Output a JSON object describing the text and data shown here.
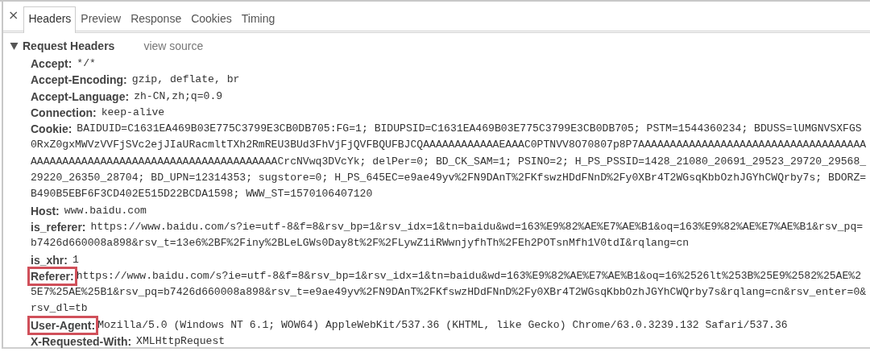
{
  "close_button": "×",
  "tabs": [
    {
      "label": "Headers",
      "selected": true
    },
    {
      "label": "Preview",
      "selected": false
    },
    {
      "label": "Response",
      "selected": false
    },
    {
      "label": "Cookies",
      "selected": false
    },
    {
      "label": "Timing",
      "selected": false
    }
  ],
  "section": {
    "title": "Request Headers",
    "expanded": true,
    "link": "view source",
    "headers": [
      {
        "name": "Accept:",
        "value": "*/*",
        "highlighted": false
      },
      {
        "name": "Accept-Encoding:",
        "value": "gzip, deflate, br",
        "highlighted": false
      },
      {
        "name": "Accept-Language:",
        "value": "zh-CN,zh;q=0.9",
        "highlighted": false
      },
      {
        "name": "Connection:",
        "value": "keep-alive",
        "highlighted": false
      },
      {
        "name": "Cookie:",
        "value": "BAIDUID=C1631EA469B03E775C3799E3CB0DB705:FG=1; BIDUPSID=C1631EA469B03E775C3799E3CB0DB705; PSTM=1544360234; BDUSS=lUMGNVSXFGS0RxZ0gxMWVzVVFjSVc2ejJIaURacmltTXh2RmREU3BUd3FhVjFjQVFBQUFBJCQAAAAAAAAAAAAEAAAC0PTNVV8O70807p8P7AAAAAAAAAAAAAAAAAAAAAAAAAAAAAAAAAAAAAAAAAAAAAAAAAAAAAAAAAAAAAAAAAAAAAAAAAAACrcNVwq3DVcYk; delPer=0; BD_CK_SAM=1; PSINO=2; H_PS_PSSID=1428_21080_20691_29523_29720_29568_29220_26350_28704; BD_UPN=12314353; sugstore=0; H_PS_645EC=e9ae49yv%2FN9DAnT%2FKfswzHDdFNnD%2Fy0XBr4T2WGsqKbbOzhJGYhCWQrby7s; BDORZ=B490B5EBF6F3CD402E515D22BCDA1598; WWW_ST=1570106407120",
        "highlighted": false
      },
      {
        "name": "Host:",
        "value": "www.baidu.com",
        "highlighted": false
      },
      {
        "name": "is_referer:",
        "value": "https://www.baidu.com/s?ie=utf-8&f=8&rsv_bp=1&rsv_idx=1&tn=baidu&wd=163%E9%82%AE%E7%AE%B1&oq=163%E9%82%AE%E7%AE%B1&rsv_pq=b7426d660008a898&rsv_t=13e6%2BF%2Finy%2BLeLGWs0Day8t%2F%2FLywZ1iRWwnjyfhTh%2FEh2POTsnMfh1V0tdI&rqlang=cn",
        "highlighted": false
      },
      {
        "name": "is_xhr:",
        "value": "1",
        "highlighted": false
      },
      {
        "name": "Referer:",
        "value": "https://www.baidu.com/s?ie=utf-8&f=8&rsv_bp=1&rsv_idx=1&tn=baidu&wd=163%E9%82%AE%E7%AE%B1&oq=16%2526lt%253B%25E9%2582%25AE%25E7%25AE%25B1&rsv_pq=b7426d660008a898&rsv_t=e9ae49yv%2FN9DAnT%2FKfswzHDdFNnD%2Fy0XBr4T2WGsqKbbOzhJGYhCWQrby7s&rqlang=cn&rsv_enter=0&rsv_dl=tb",
        "highlighted": true
      },
      {
        "name": "User-Agent:",
        "value": "Mozilla/5.0 (Windows NT 6.1; WOW64) AppleWebKit/537.36 (KHTML, like Gecko) Chrome/63.0.3239.132 Safari/537.36",
        "highlighted": true
      },
      {
        "name": "X-Requested-With:",
        "value": "XMLHttpRequest",
        "highlighted": false
      }
    ]
  }
}
